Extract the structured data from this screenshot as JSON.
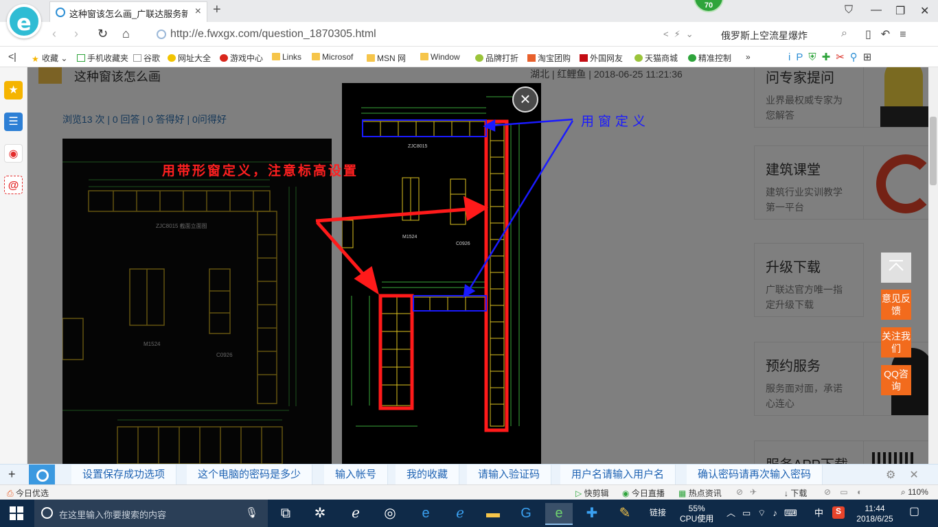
{
  "browser": {
    "tab_title": "这种窗该怎么画_广联达服务新干线",
    "url": "http://e.fwxgx.com/question_1870305.html",
    "search_text": "俄罗斯上空流星爆炸",
    "badge": "70"
  },
  "bookmarks": [
    "收藏",
    "手机收藏夹",
    "谷歌",
    "网址大全",
    "游戏中心",
    "Links",
    "Microsof",
    "MSN 网",
    "Window",
    "品牌打折",
    "淘宝团购",
    "外国网友",
    "天猫商城",
    "精准控制"
  ],
  "question": {
    "title": "这种窗该怎么画",
    "meta": "湖北 | 红鲤鱼 | 2018-06-25 11:21:36",
    "stats": "浏览13 次 | 0 回答 | 0 答得好 | 0问得好"
  },
  "side_cards": [
    {
      "title": "问专家提问",
      "desc": "业界最权威专家为您解答"
    },
    {
      "title": "建筑课堂",
      "desc": "建筑行业实训教学第一平台"
    },
    {
      "title": "升级下载",
      "desc": "广联达官方唯一指定升级下载"
    },
    {
      "title": "预约服务",
      "desc": "服务面对面，承诺心连心"
    },
    {
      "title": "服务APP下载",
      "desc": ""
    }
  ],
  "float_buttons": [
    "意见反馈",
    "关注我们",
    "QQ咨询"
  ],
  "modal": {
    "annotation_red": "用带形窗定义，注意标高设置",
    "annotation_blue": "用窗定义",
    "close": "×"
  },
  "cad_labels": {
    "left_title": "ZJC8015 截面立面图",
    "m1524": "M1524",
    "c0926": "C0926"
  },
  "suggestions": [
    "设置保存成功选项",
    "这个电脑的密码是多少",
    "输入帐号",
    "我的收藏",
    "请输入验证码",
    "用户名请输入用户名",
    "确认密码请再次输入密码"
  ],
  "statusbar": {
    "left": "今日优选",
    "items": [
      "快剪辑",
      "今日直播",
      "热点资讯",
      "下载"
    ],
    "zoom": "110%"
  },
  "taskbar": {
    "search_placeholder": "在这里输入你要搜索的内容",
    "cpu": "55%",
    "cpu_label": "CPU使用",
    "link": "链接",
    "ime": "中",
    "time": "11:44",
    "date": "2018/6/25"
  },
  "colors": {
    "annot_red": "#ff2020",
    "annot_blue": "#1a1aff",
    "accent_orange": "#f26b1d"
  }
}
